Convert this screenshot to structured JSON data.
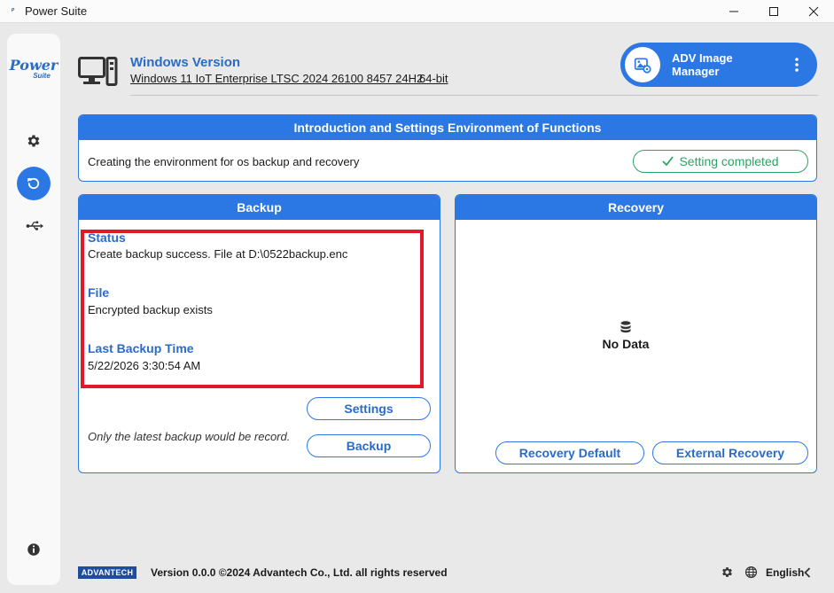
{
  "window": {
    "title": "Power Suite",
    "logo_line1": "Power",
    "logo_line2": "Suite"
  },
  "sidebar": {
    "items": [
      {
        "name": "settings",
        "icon": "gear-icon",
        "active": false
      },
      {
        "name": "backup-recovery",
        "icon": "restore-icon",
        "active": true
      },
      {
        "name": "usb",
        "icon": "usb-icon",
        "active": false
      },
      {
        "name": "info",
        "icon": "info-icon",
        "active": false
      }
    ]
  },
  "header": {
    "os_label": "Windows Version",
    "os_value": "Windows 11 IoT Enterprise LTSC 2024 26100 8457 24H2",
    "os_bits": "64-bit",
    "adv_manager_title": "ADV Image Manager"
  },
  "intro": {
    "title": "Introduction and Settings Environment of Functions",
    "description": "Creating the environment for os backup and recovery",
    "status": "Setting completed"
  },
  "backup": {
    "title": "Backup",
    "status_label": "Status",
    "status_value": "Create backup success. File at D:\\0522backup.enc",
    "file_label": "File",
    "file_value": "Encrypted backup exists",
    "time_label": "Last Backup Time",
    "time_value": "5/22/2026 3:30:54 AM",
    "settings_button": "Settings",
    "backup_button": "Backup",
    "note": "Only the latest backup would be record."
  },
  "recovery": {
    "title": "Recovery",
    "empty_text": "No Data",
    "default_button": "Recovery Default",
    "external_button": "External Recovery"
  },
  "footer": {
    "brand": "ADVANTECH",
    "version_text": "Version 0.0.0 ©2024 Advantech Co., Ltd. all rights reserved",
    "language": "English"
  },
  "colors": {
    "accent": "#2b78e4",
    "success": "#2aa564",
    "highlight": "#e0192b"
  }
}
